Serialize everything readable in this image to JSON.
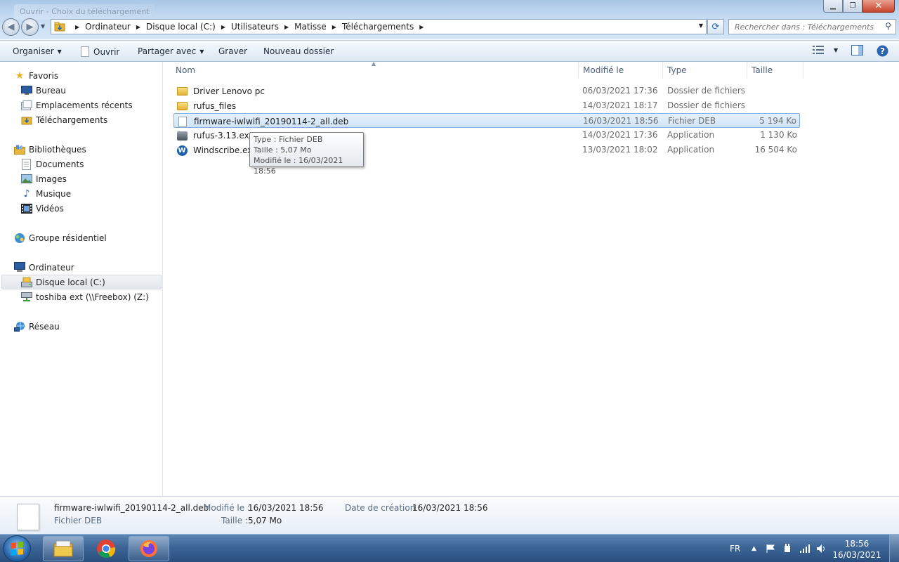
{
  "window": {
    "ghost_title": "Ouvrir - Choix du téléchargement",
    "controls": {
      "minimize": "minimize-icon",
      "maximize": "maximize-icon",
      "close": "close-icon"
    }
  },
  "address": {
    "breadcrumbs": [
      "Ordinateur",
      "Disque local (C:)",
      "Utilisateurs",
      "Matisse",
      "Téléchargements"
    ],
    "search_placeholder": "Rechercher dans : Téléchargements"
  },
  "toolbar": {
    "organiser": "Organiser",
    "ouvrir": "Ouvrir",
    "partager": "Partager avec",
    "graver": "Graver",
    "nouveau_dossier": "Nouveau dossier"
  },
  "nav": {
    "favoris": "Favoris",
    "bureau": "Bureau",
    "recents": "Emplacements récents",
    "telechargements": "Téléchargements",
    "bibliotheques": "Bibliothèques",
    "documents": "Documents",
    "images": "Images",
    "musique": "Musique",
    "videos": "Vidéos",
    "groupe": "Groupe résidentiel",
    "ordinateur": "Ordinateur",
    "disque": "Disque local (C:)",
    "toshiba": "toshiba ext (\\\\Freebox) (Z:)",
    "reseau": "Réseau"
  },
  "columns": {
    "name": "Nom",
    "modified": "Modifié le",
    "type": "Type",
    "size": "Taille"
  },
  "files": [
    {
      "name": "Driver Lenovo pc",
      "modified": "06/03/2021 17:36",
      "type": "Dossier de fichiers",
      "size": "",
      "icon": "folder-icon"
    },
    {
      "name": "rufus_files",
      "modified": "14/03/2021 18:17",
      "type": "Dossier de fichiers",
      "size": "",
      "icon": "folder-icon"
    },
    {
      "name": "firmware-iwlwifi_20190114-2_all.deb",
      "modified": "16/03/2021 18:56",
      "type": "Fichier DEB",
      "size": "5 194 Ko",
      "icon": "file-icon"
    },
    {
      "name": "rufus-3.13.exe",
      "modified": "14/03/2021 17:36",
      "type": "Application",
      "size": "1 130 Ko",
      "icon": "usb-drive-icon"
    },
    {
      "name": "Windscribe.exe",
      "modified": "13/03/2021 18:02",
      "type": "Application",
      "size": "16 504 Ko",
      "icon": "windscribe-icon"
    }
  ],
  "tooltip": {
    "type": "Type : Fichier DEB",
    "size": "Taille : 5,07 Mo",
    "modified": "Modifié le : 16/03/2021 18:56"
  },
  "details": {
    "filename": "firmware-iwlwifi_20190114-2_all.deb",
    "filetype": "Fichier DEB",
    "modified_label": "Modifié le :",
    "modified_value": "16/03/2021 18:56",
    "size_label": "Taille :",
    "size_value": "5,07 Mo",
    "created_label": "Date de création :",
    "created_value": "16/03/2021 18:56"
  },
  "taskbar": {
    "language": "FR",
    "time": "18:56",
    "date": "16/03/2021"
  },
  "colors": {
    "accent": "#3c6596",
    "selection": "#cfe4f9",
    "folder": "#e3b233"
  }
}
